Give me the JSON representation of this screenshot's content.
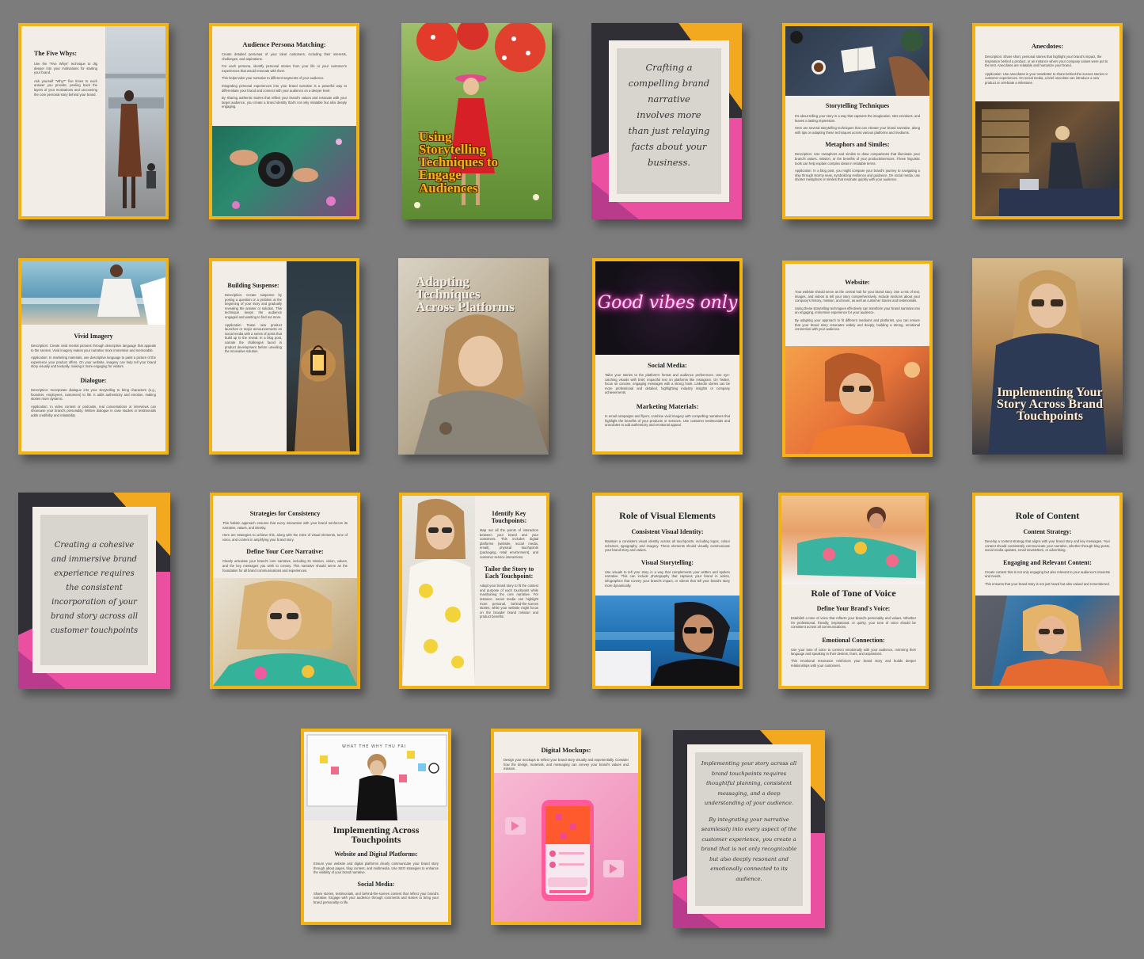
{
  "pages": {
    "five_whys": {
      "title": "The Five Whys:",
      "p1": "Use the \"Five Whys\" technique to dig deeper into your motivations for starting your brand.",
      "p2": "Ask yourself \"Why?\" five times to each answer you provide, peeling back the layers of your motivations and uncovering the core personal story behind your brand."
    },
    "persona": {
      "title": "Audience Persona Matching:",
      "p1": "Create detailed personas of your ideal customers, including their interests, challenges, and aspirations.",
      "p2": "For each persona, identify personal stories from your life or your customer's experiences that would resonate with them.",
      "p3": "This helps tailor your narrative to different segments of your audience.",
      "p4": "Integrating personal experiences into your brand narrative is a powerful way to differentiate your brand and connect with your audience on a deeper level.",
      "p5": "By sharing authentic stories that reflect your brand's values and resonate with your target audience, you create a brand identity that's not only relatable but also deeply engaging."
    },
    "cover_storytelling": {
      "title": "Using Storytelling Techniques to Engage Audiences"
    },
    "quote_crafting": {
      "text": "Crafting a compelling brand narrative involves more than just relaying facts about your business."
    },
    "techniques": {
      "title1": "Storytelling Techniques",
      "p1": "It's about telling your story in a way that captures the imagination, stirs emotions, and leaves a lasting impression.",
      "p2": "Here are several storytelling techniques that can elevate your brand narrative, along with tips on adapting these techniques across various platforms and mediums.",
      "title2": "Metaphors and Similes:",
      "p3": "Description: Use metaphors and similes to draw comparisons that illuminate your brand's values, mission, or the benefits of your products/services. These linguistic tools can help explain complex ideas in relatable terms.",
      "p4": "Application: In a blog post, you might compare your brand's journey to navigating a ship through stormy seas, symbolizing resilience and guidance. On social media, use shorter metaphors or similes that resonate quickly with your audience."
    },
    "anecdotes": {
      "title": "Anecdotes:",
      "p1": "Description: Share short, personal stories that highlight your brand's impact, the inspiration behind a product, or an instance where your company values were put to the test. Anecdotes are relatable and humanize your brand.",
      "p2": "Application: Use anecdotes in your newsletter to share behind-the-scenes stories or customer experiences. On social media, a brief anecdote can introduce a new product or celebrate a milestone."
    },
    "vivid": {
      "title1": "Vivid Imagery",
      "p1": "Description: Create vivid mental pictures through descriptive language that appeals to the senses. Vivid imagery makes your narrative more immersive and memorable.",
      "p2": "Application: In marketing materials, use descriptive language to paint a picture of the experience your product offers. On your website, imagery can help tell your brand story visually and textually, making it more engaging for visitors.",
      "title2": "Dialogue:",
      "p3": "Description: Incorporate dialogue into your storytelling to bring characters (e.g., founders, employees, customers) to life. It adds authenticity and emotion, making stories more dynamic.",
      "p4": "Application: In video content or podcasts, real conversations or interviews can showcase your brand's personality. Written dialogue in case studies or testimonials adds credibility and relatability."
    },
    "suspense": {
      "title": "Building Suspense:",
      "p1": "Description: Create suspense by posing a question or a problem at the beginning of your story and gradually revealing the answer or solution. This technique keeps the audience engaged and wanting to find out more.",
      "p2": "Application: Tease new product launches or major announcements on social media with a series of posts that build up to the reveal. In a blog post, narrate the challenges faced in product development before unveiling the innovative solution."
    },
    "cover_adapting": {
      "title": "Adapting Techniques Across Platforms"
    },
    "social": {
      "neon": "Good vibes only",
      "title1": "Social Media:",
      "p1": "Tailor your stories to the platform's format and audience preferences. Use eye-catching visuals with brief, impactful text on platforms like Instagram. On Twitter, focus on concise, engaging messages with a strong hook. LinkedIn stories can be more professional and detailed, highlighting industry insights or company achievements.",
      "title2": "Marketing Materials:",
      "p2": "In email campaigns and flyers, combine vivid imagery with compelling narratives that highlight the benefits of your products or services. Use customer testimonials and anecdotes to add authenticity and emotional appeal."
    },
    "website": {
      "title": "Website:",
      "p1": "Your website should serve as the central hub for your brand story. Use a mix of text, images, and videos to tell your story comprehensively. Include sections about your company's history, mission, and team, as well as customer stories and testimonials.",
      "p2": "Using these storytelling techniques effectively can transform your brand narrative into an engaging, immersive experience for your audience.",
      "p3": "By adapting your approach to fit different mediums and platforms, you can ensure that your brand story resonates widely and deeply, building a strong, emotional connection with your audience."
    },
    "cover_implementing": {
      "title": "Implementing Your Story Across Brand Touchpoints"
    },
    "quote_cohesive": {
      "text": "Creating a cohesive and immersive brand experience requires the consistent incorporation of your brand story across all customer touchpoints"
    },
    "consistency": {
      "title1": "Strategies for Consistency",
      "p1": "This holistic approach ensures that every interaction with your brand reinforces its narrative, values, and identity.",
      "p2": "Here are strategies to achieve this, along with the roles of visual elements, tone of voice, and content in amplifying your brand story.",
      "title2": "Define Your Core Narrative:",
      "p3": "Clearly articulate your brand's core narrative, including its mission, vision, values, and the key messages you wish to convey. This narrative should serve as the foundation for all brand communications and experiences."
    },
    "touchpoints": {
      "title1": "Identify Key Touchpoints:",
      "p1": "Map out all the points of interaction between your brand and your customers. This includes digital platforms (website, social media, email), physical touchpoints (packaging, retail environment), and customer service interactions.",
      "title2": "Tailor the Story to Each Touchpoint:",
      "p2": "Adapt your brand story to fit the context and purpose of each touchpoint while maintaining the core narrative. For instance, social media can highlight more personal, behind-the-scenes stories, while your website might focus on the broader brand mission and product benefits."
    },
    "visual": {
      "title1": "Role of Visual Elements",
      "title2": "Consistent Visual Identity:",
      "p1": "Maintain a consistent visual identity across all touchpoints, including logos, colour schemes, typography, and imagery. These elements should visually communicate your brand story and values.",
      "title3": "Visual Storytelling:",
      "p2": "Use visuals to tell your story in a way that complements your written and spoken narrative. This can include photography that captures your brand in action, infographics that convey your brand's impact, or videos that tell your brand's story more dynamically."
    },
    "tone": {
      "title1": "Role of Tone of Voice",
      "title2": "Define Your Brand's Voice:",
      "p1": "Establish a tone of voice that reflects your brand's personality and values. Whether it's professional, friendly, inspirational, or quirky, your tone of voice should be consistent across all communications.",
      "title3": "Emotional Connection:",
      "p2": "Use your tone of voice to connect emotionally with your audience, mirroring their language and speaking to their desires, fears, and aspirations.",
      "p3": "This emotional resonance reinforces your brand story and builds deeper relationships with your customers."
    },
    "content": {
      "title1": "Role of Content",
      "title2": "Content Strategy:",
      "p1": "Develop a content strategy that aligns with your brand story and key messages. Your content should consistently communicate your narrative, whether through blog posts, social media updates, email newsletters, or advertising.",
      "title3": "Engaging and Relevant Content:",
      "p2": "Create content that is not only engaging but also relevant to your audience's interests and needs.",
      "p3": "This ensures that your brand story is not just heard but also valued and remembered."
    },
    "across": {
      "board": "WHAT THE WHY THU FRI",
      "title1": "Implementing Across Touchpoints",
      "title2": "Website and Digital Platforms:",
      "p1": "Ensure your website and digital platforms clearly communicate your brand story through about pages, blog content, and multimedia. Use SEO strategies to enhance the visibility of your brand narrative.",
      "title3": "Social Media:",
      "p2": "Share stories, testimonials, and behind-the-scenes content that reflect your brand's narrative. Engage with your audience through comments and stories to bring your brand personality to life."
    },
    "mockups": {
      "title": "Digital Mockups:",
      "p1": "Design your mockups to reflect your brand story visually and experientially. Consider how the design, materials, and messaging can convey your brand's values and mission."
    },
    "quote_final": {
      "text1": "Implementing your story across all brand touchpoints requires thoughtful planning, consistent messaging, and a deep understanding of your audience.",
      "text2": "By integrating your narrative seamlessly into every aspect of the customer experience, you create a brand that is not only recognizable but also deeply resonant and emotionally connected to its audience."
    }
  },
  "colors": {
    "background": "#7c7c7c",
    "border": "#f2b316",
    "paper": "#f2eee7",
    "pink": "#ea4fa0",
    "dark": "#2f2f35",
    "orange": "#f2a91f"
  }
}
